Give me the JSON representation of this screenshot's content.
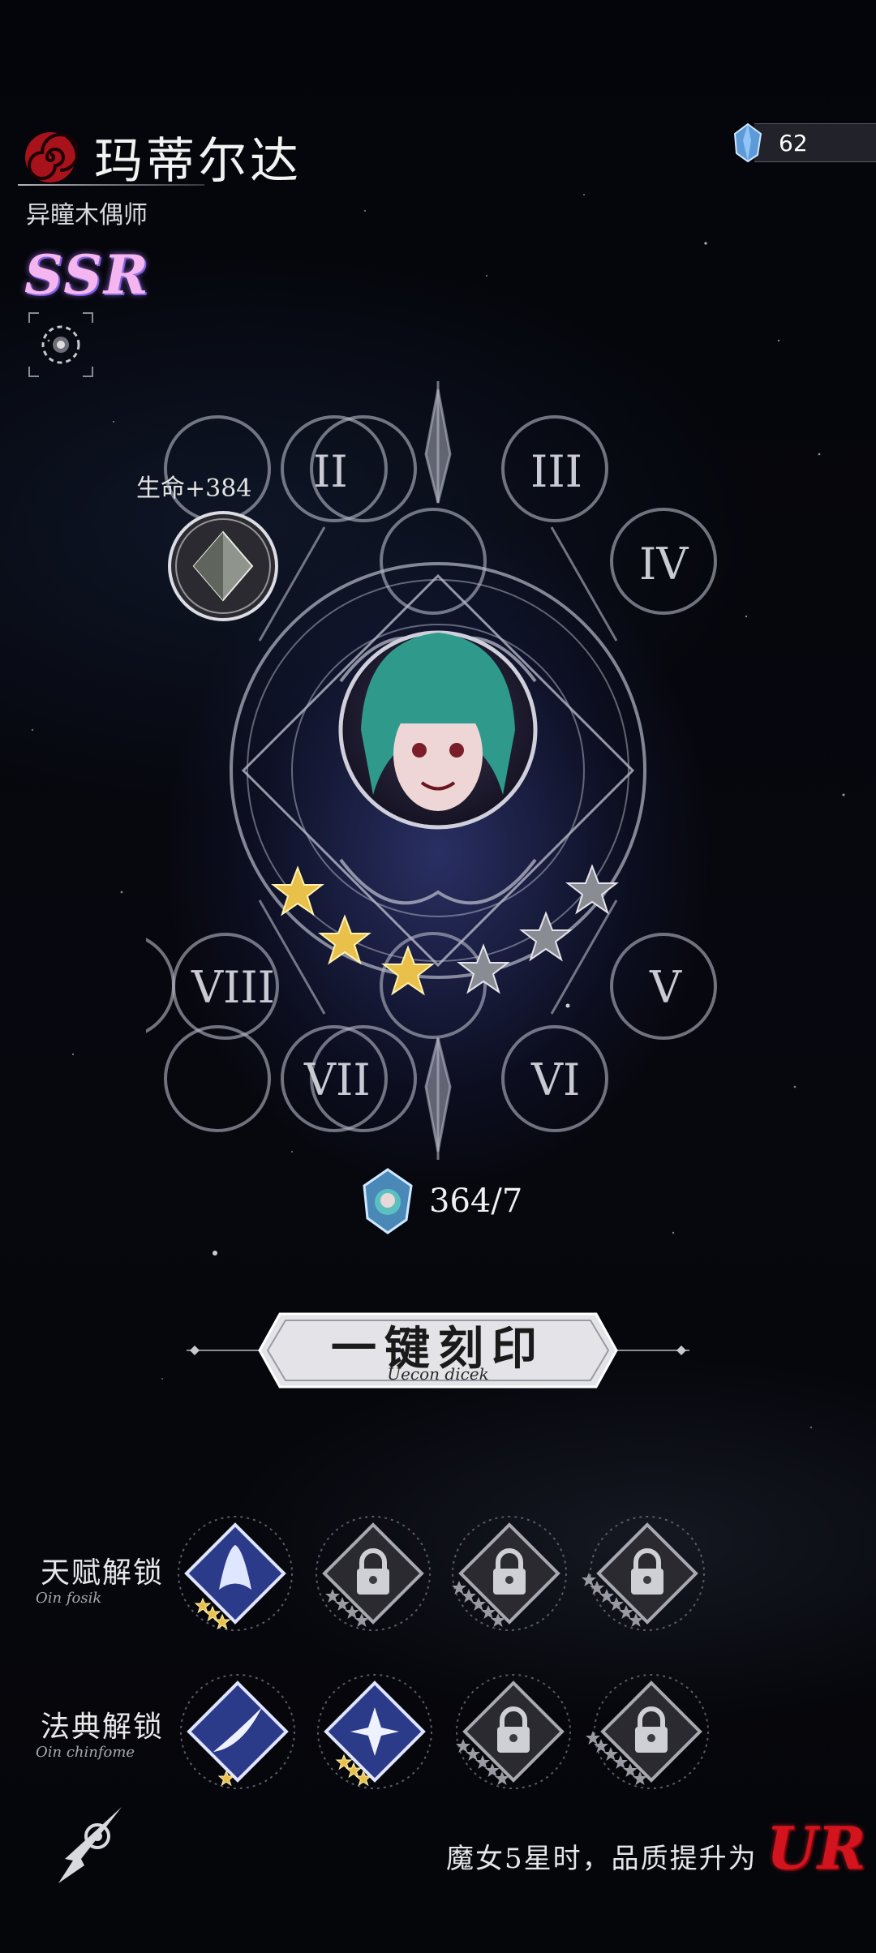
{
  "header": {
    "title": "玛蒂尔达",
    "subtitle": "异瞳木偶师",
    "rarity": "SSR",
    "logo_icon": "red-spiral-emblem-icon",
    "skill_icon": "gear-orb-icon"
  },
  "currency": {
    "icon": "blue-crystal-icon",
    "amount": "62"
  },
  "wheel": {
    "slot_labels": [
      "II",
      "III",
      "IV",
      "V",
      "VI",
      "VII",
      "VIII"
    ],
    "selected_attribute": "生命+384",
    "stars_total": 6,
    "stars_filled": 3
  },
  "cost": {
    "icon": "character-fragment-icon",
    "text": "364/7"
  },
  "imprint_button": {
    "label": "一键刻印",
    "sublabel": "Uecon dicek"
  },
  "talent_row": {
    "label": "天赋解锁",
    "sublabel": "Oin fosik",
    "slots": [
      {
        "state": "unlocked",
        "stars": 3
      },
      {
        "state": "locked",
        "stars": 4
      },
      {
        "state": "locked",
        "stars": 5
      },
      {
        "state": "locked",
        "stars": 6
      }
    ]
  },
  "codex_row": {
    "label": "法典解锁",
    "sublabel": "Oin chinfome",
    "slots": [
      {
        "state": "unlocked",
        "stars": 1
      },
      {
        "state": "unlocked",
        "stars": 3
      },
      {
        "state": "locked",
        "stars": 5
      },
      {
        "state": "locked",
        "stars": 6
      }
    ]
  },
  "footer": {
    "text": "魔女5星时，品质提升为",
    "quality": "UR",
    "back_icon": "rose-arrow-back-icon"
  },
  "colors": {
    "accent_gold": "#e8c04a",
    "ur_red": "#d3131d",
    "rarity_pink": "#f5b6ef"
  }
}
